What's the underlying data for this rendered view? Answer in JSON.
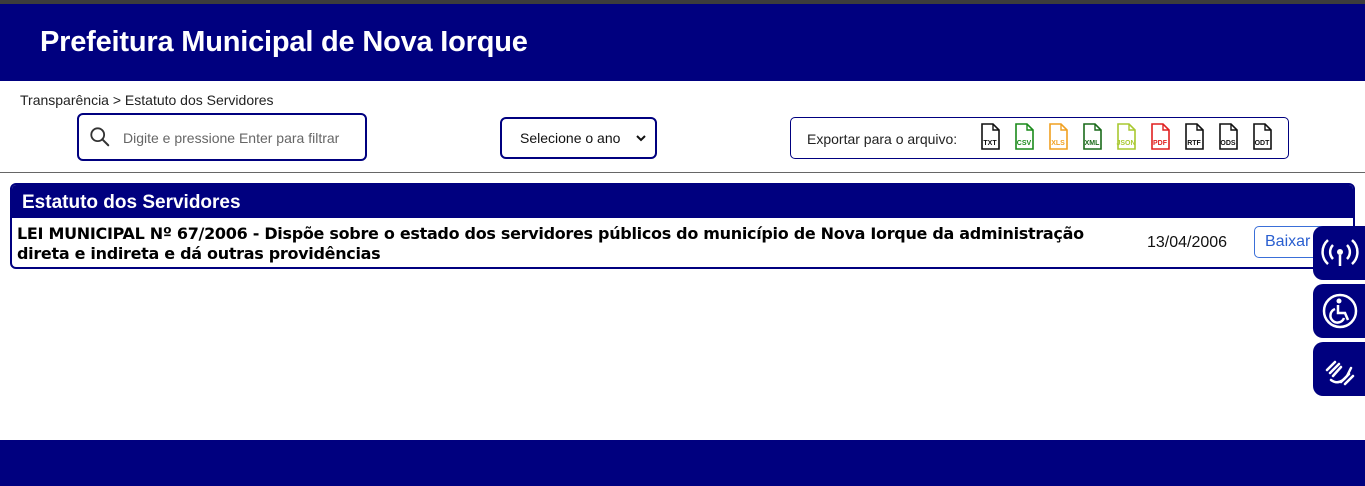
{
  "header": {
    "title": "Prefeitura Municipal de Nova Iorque"
  },
  "breadcrumb": {
    "text": "Transparência > Estatuto dos Servidores"
  },
  "search": {
    "placeholder": "Digite e pressione Enter para filtrar"
  },
  "year_select": {
    "selected": "Selecione o ano"
  },
  "export": {
    "label": "Exportar para o arquivo:",
    "formats": [
      {
        "name": "TXT",
        "color": "#111111"
      },
      {
        "name": "CSV",
        "color": "#1a8a1a"
      },
      {
        "name": "XLS",
        "color": "#f0a020"
      },
      {
        "name": "XML",
        "color": "#1a6a1a"
      },
      {
        "name": "JSON",
        "color": "#a8c830"
      },
      {
        "name": "PDF",
        "color": "#e02020"
      },
      {
        "name": "RTF",
        "color": "#111111"
      },
      {
        "name": "ODS",
        "color": "#111111"
      },
      {
        "name": "ODT",
        "color": "#111111"
      }
    ]
  },
  "panel": {
    "title": "Estatuto dos Servidores",
    "rows": [
      {
        "description": "LEI MUNICIPAL Nº 67/2006 - Dispõe sobre o estado dos servidores públicos do município de Nova Iorque da administração direta e indireta e dá outras providências",
        "date": "13/04/2006",
        "action": "Baixar"
      }
    ]
  },
  "accessibility": [
    "audio-broadcast-icon",
    "wheelchair-icon",
    "sign-language-icon"
  ],
  "colors": {
    "brand": "#00007f",
    "link": "#2a5fd0"
  }
}
